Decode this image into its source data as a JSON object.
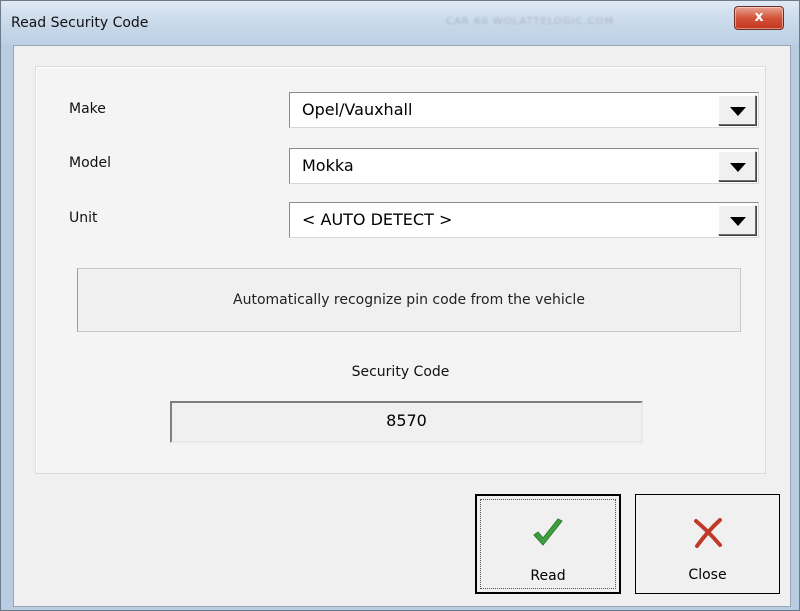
{
  "window": {
    "title": "Read Security Code",
    "close_glyph": "x",
    "title_ghost": "CAR 60    WOLATTELOGIC.COM"
  },
  "form": {
    "make": {
      "label": "Make",
      "value": "Opel/Vauxhall"
    },
    "model": {
      "label": "Model",
      "value": "Mokka"
    },
    "unit": {
      "label": "Unit",
      "value": "< AUTO DETECT >"
    }
  },
  "info": {
    "text": "Automatically recognize pin code from the vehicle"
  },
  "security": {
    "label": "Security Code",
    "value": "8570"
  },
  "buttons": {
    "read": {
      "label": "Read",
      "icon": "checkmark-icon",
      "icon_color": "#3a9a3a"
    },
    "close": {
      "label": "Close",
      "icon": "close-x-icon",
      "icon_color": "#c0392b"
    }
  },
  "colors": {
    "accent_close": "#c4351d",
    "titlebar": "#c9d9ea"
  }
}
